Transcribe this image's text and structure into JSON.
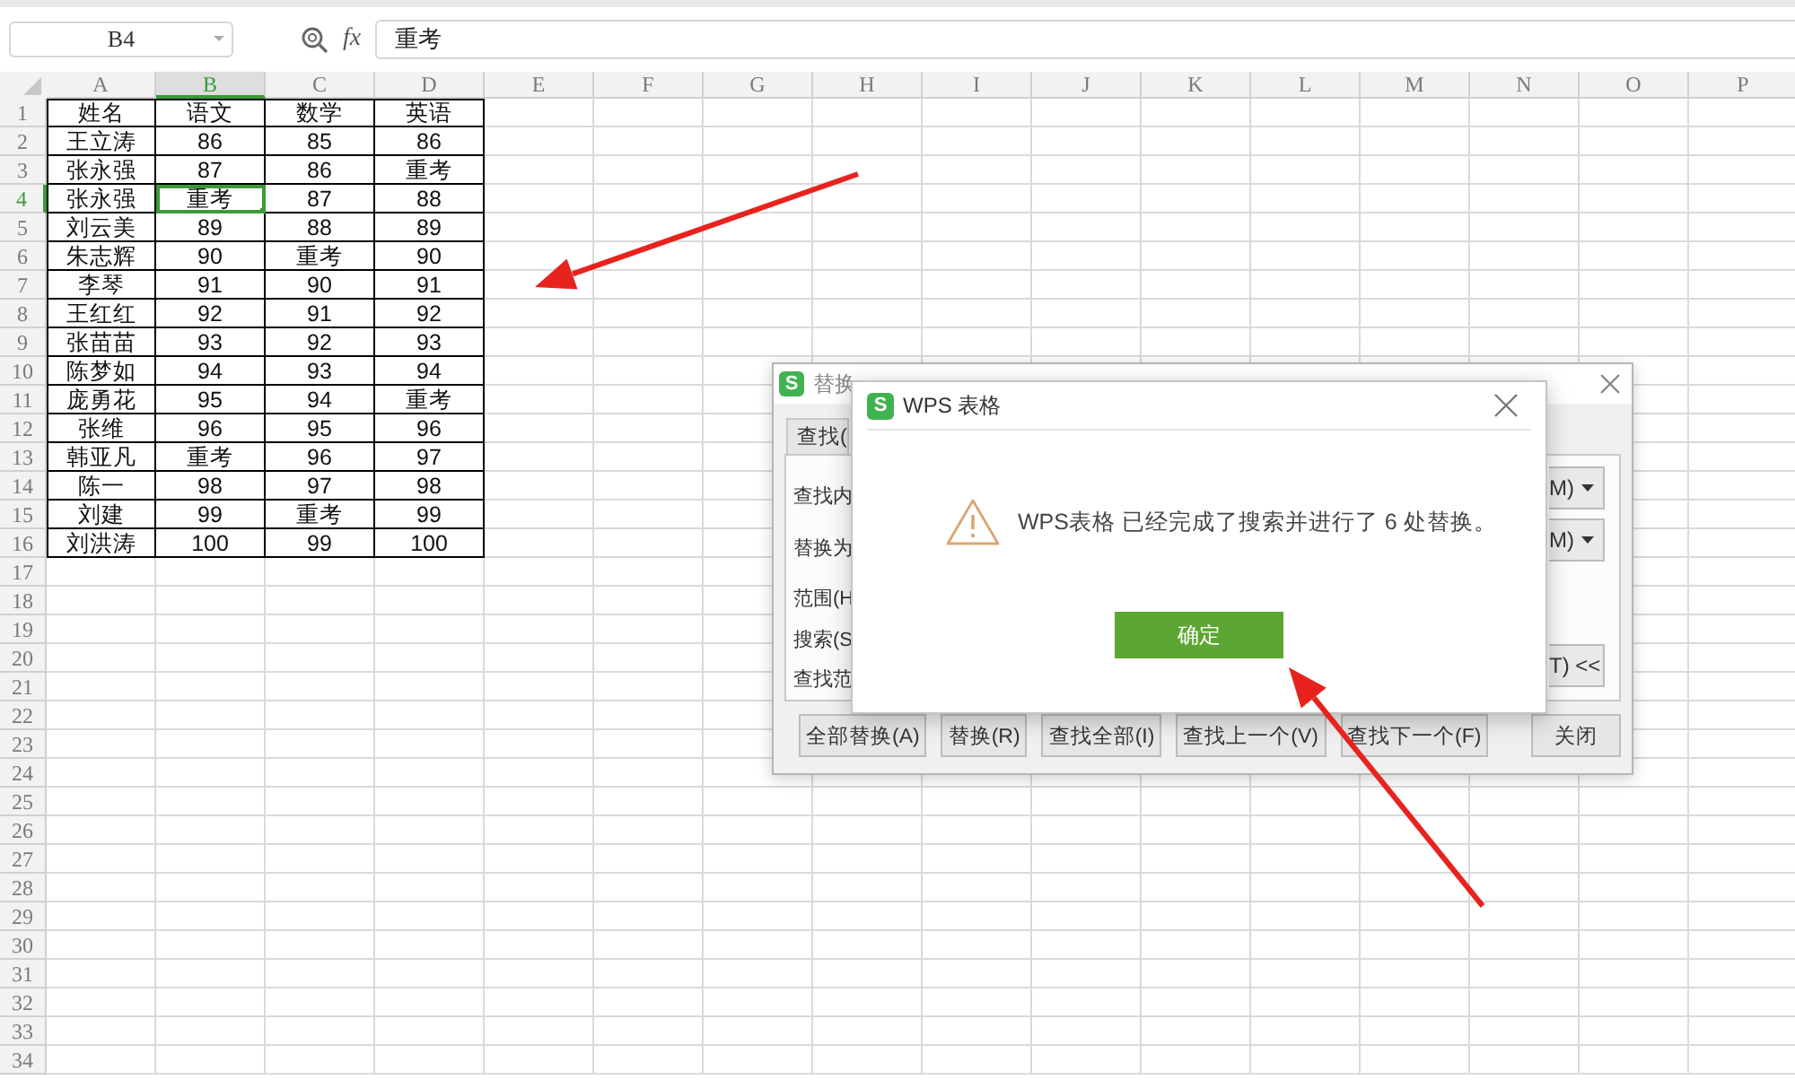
{
  "name_box": {
    "value": "B4"
  },
  "formula_bar": {
    "fx": "fx",
    "value": "重考"
  },
  "sheet": {
    "columns": [
      {
        "label": "A",
        "selected": false
      },
      {
        "label": "B",
        "selected": true
      },
      {
        "label": "C",
        "selected": false
      },
      {
        "label": "D",
        "selected": false
      },
      {
        "label": "E",
        "selected": false
      },
      {
        "label": "F",
        "selected": false
      },
      {
        "label": "G",
        "selected": false
      },
      {
        "label": "H",
        "selected": false
      },
      {
        "label": "I",
        "selected": false
      },
      {
        "label": "J",
        "selected": false
      },
      {
        "label": "K",
        "selected": false
      },
      {
        "label": "L",
        "selected": false
      },
      {
        "label": "M",
        "selected": false
      },
      {
        "label": "N",
        "selected": false
      },
      {
        "label": "O",
        "selected": false
      },
      {
        "label": "P",
        "selected": false
      }
    ],
    "rows": [
      {
        "label": "1",
        "selected": false,
        "cells": [
          "姓名",
          "语文",
          "数学",
          "英语"
        ]
      },
      {
        "label": "2",
        "selected": false,
        "cells": [
          "王立涛",
          "86",
          "85",
          "86"
        ]
      },
      {
        "label": "3",
        "selected": false,
        "cells": [
          "张永强",
          "87",
          "86",
          "重考"
        ]
      },
      {
        "label": "4",
        "selected": true,
        "cells": [
          "张永强",
          "重考",
          "87",
          "88"
        ]
      },
      {
        "label": "5",
        "selected": false,
        "cells": [
          "刘云美",
          "89",
          "88",
          "89"
        ]
      },
      {
        "label": "6",
        "selected": false,
        "cells": [
          "朱志辉",
          "90",
          "重考",
          "90"
        ]
      },
      {
        "label": "7",
        "selected": false,
        "cells": [
          "李琴",
          "91",
          "90",
          "91"
        ]
      },
      {
        "label": "8",
        "selected": false,
        "cells": [
          "王红红",
          "92",
          "91",
          "92"
        ]
      },
      {
        "label": "9",
        "selected": false,
        "cells": [
          "张苗苗",
          "93",
          "92",
          "93"
        ]
      },
      {
        "label": "10",
        "selected": false,
        "cells": [
          "陈梦如",
          "94",
          "93",
          "94"
        ]
      },
      {
        "label": "11",
        "selected": false,
        "cells": [
          "庞勇花",
          "95",
          "94",
          "重考"
        ]
      },
      {
        "label": "12",
        "selected": false,
        "cells": [
          "张维",
          "96",
          "95",
          "96"
        ]
      },
      {
        "label": "13",
        "selected": false,
        "cells": [
          "韩亚凡",
          "重考",
          "96",
          "97"
        ]
      },
      {
        "label": "14",
        "selected": false,
        "cells": [
          "陈一",
          "98",
          "97",
          "98"
        ]
      },
      {
        "label": "15",
        "selected": false,
        "cells": [
          "刘建",
          "99",
          "重考",
          "99"
        ]
      },
      {
        "label": "16",
        "selected": false,
        "cells": [
          "刘洪涛",
          "100",
          "99",
          "100"
        ]
      },
      {
        "label": "17",
        "selected": false
      },
      {
        "label": "18",
        "selected": false
      },
      {
        "label": "19",
        "selected": false
      },
      {
        "label": "20",
        "selected": false
      },
      {
        "label": "21",
        "selected": false
      },
      {
        "label": "22",
        "selected": false
      },
      {
        "label": "23",
        "selected": false
      },
      {
        "label": "24",
        "selected": false
      },
      {
        "label": "25",
        "selected": false
      },
      {
        "label": "26",
        "selected": false
      },
      {
        "label": "27",
        "selected": false
      },
      {
        "label": "28",
        "selected": false
      },
      {
        "label": "29",
        "selected": false
      },
      {
        "label": "30",
        "selected": false
      },
      {
        "label": "31",
        "selected": false
      },
      {
        "label": "32",
        "selected": false
      },
      {
        "label": "33",
        "selected": false
      },
      {
        "label": "34",
        "selected": false
      }
    ]
  },
  "replace_dialog": {
    "logo": "S",
    "title": "替换",
    "tabs": [
      {
        "label": "查找(",
        "selected": false
      }
    ],
    "labels": [
      "查找内",
      "替换为",
      "范围(H",
      "搜索(S",
      "查找范"
    ],
    "dropdowns": [
      {
        "text": "M)"
      },
      {
        "text": "M)"
      }
    ],
    "options_button": "T) <<",
    "buttons": [
      "全部替换(A)",
      "替换(R)",
      "查找全部(I)",
      "查找上一个(V)",
      "查找下一个(F)",
      "关闭"
    ]
  },
  "message_dialog": {
    "logo": "S",
    "title": "WPS 表格",
    "message": "WPS表格 已经完成了搜索并进行了 6 处替换。",
    "ok_button": "确定"
  }
}
